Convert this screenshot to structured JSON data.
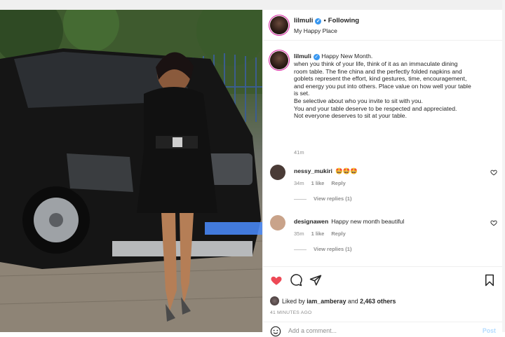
{
  "post": {
    "username": "lilmuli",
    "verified_glyph": "✓",
    "separator": "•",
    "follow_state": "Following",
    "location": "My Happy Place"
  },
  "caption": {
    "username": "lilmuli",
    "text_lines": [
      "Happy New Month.",
      "when you think of your life, think of it as an immaculate dining",
      "room table. The fine china and the perfectly folded napkins and",
      "goblets represent the effort, kind gestures, time, encouragement,",
      "and energy you put into others. Place value on how well your table",
      "is set.",
      "Be selective about who you invite to sit with you.",
      "You and your table deserve to be respected and appreciated.",
      "Not everyone deserves to sit at your table."
    ],
    "time": "41m"
  },
  "comments": [
    {
      "username": "nessy_mukiri",
      "text": "🤩🤩🤩",
      "time": "34m",
      "likes": "1 like",
      "reply": "Reply",
      "view_replies": "View replies (1)",
      "avatar_color": "#4a3b36"
    },
    {
      "username": "designawen",
      "text": "Happy new month beautiful",
      "time": "35m",
      "likes": "1 like",
      "reply": "Reply",
      "view_replies": "View replies (1)",
      "avatar_color": "#c9a38a"
    }
  ],
  "engagement": {
    "liked_prefix": "Liked by",
    "liked_user": "iam_amberay",
    "liked_and": "and",
    "liked_count": "2,463 others",
    "ago": "41 MINUTES AGO"
  },
  "add_comment": {
    "placeholder": "Add a comment...",
    "post_label": "Post"
  },
  "icons": [
    "heart-filled-icon",
    "comment-icon",
    "share-icon",
    "bookmark-icon",
    "smile-icon",
    "verified-badge-icon",
    "heart-outline-icon"
  ],
  "colors": {
    "like_red": "#ed4956",
    "link_blue": "#3897f0",
    "muted": "#8e8e8e",
    "post_disabled": "#b3dbff"
  }
}
